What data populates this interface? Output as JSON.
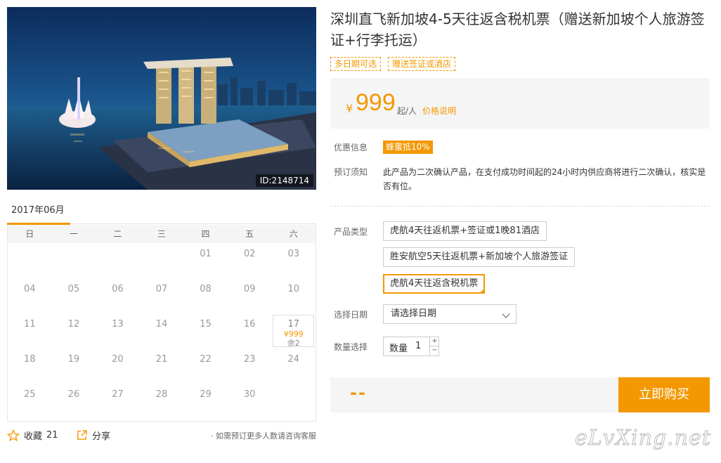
{
  "photo": {
    "id_label": "ID:2148714"
  },
  "calendar": {
    "month": "2017年06月",
    "weekdays": [
      "日",
      "一",
      "二",
      "三",
      "四",
      "五",
      "六"
    ],
    "days": [
      "",
      "",
      "",
      "",
      "01",
      "02",
      "03",
      "04",
      "05",
      "06",
      "07",
      "08",
      "09",
      "10",
      "11",
      "12",
      "13",
      "14",
      "15",
      "16",
      "17",
      "18",
      "19",
      "20",
      "21",
      "22",
      "23",
      "24",
      "25",
      "26",
      "27",
      "28",
      "29",
      "30",
      ""
    ],
    "active_day": {
      "day": "17",
      "price": "¥999",
      "remain": "余2"
    }
  },
  "bottom": {
    "fav_label": "收藏",
    "fav_count": "21",
    "share_label": "分享",
    "tip": "· 如需预订更多人数请咨询客服"
  },
  "product": {
    "title": "深圳直飞新加坡4-5天往返含税机票（赠送新加坡个人旅游签证+行李托运）",
    "tags": [
      "多日期可选",
      "赠送签证或酒店"
    ],
    "price": {
      "currency": "¥",
      "amount": "999",
      "unit": "起/人",
      "explain": "价格说明"
    },
    "promo_label": "优惠信息",
    "promo_badge": "蜂蜜抵10%",
    "notice_label": "预订须知",
    "notice_text": "此产品为二次确认产品，在支付成功时间起的24小时内供应商将进行二次确认，核实是否有位。",
    "type_label": "产品类型",
    "options": [
      "虎航4天往返机票+签证或1晚81酒店",
      "胜安航空5天往返机票+新加坡个人旅游签证",
      "虎航4天往返含税机票"
    ],
    "selected_option": 2,
    "date_label": "选择日期",
    "date_placeholder": "请选择日期",
    "qty_label_row": "数量选择",
    "qty_label": "数量",
    "qty_value": "1",
    "qty_plus": "+",
    "qty_minus": "−",
    "total": "--",
    "buy_label": "立即购买"
  },
  "watermark": "eLvXing.net",
  "colors": {
    "accent": "#f39800"
  }
}
